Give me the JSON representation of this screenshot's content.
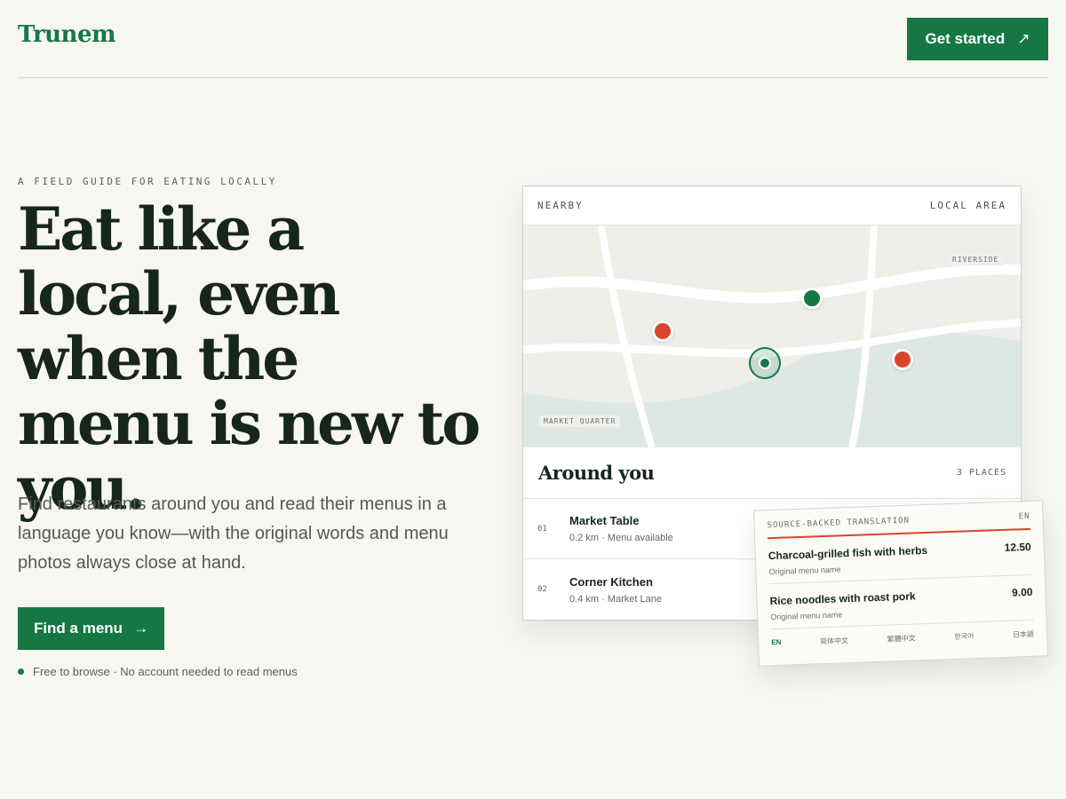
{
  "header": {
    "logo": "Trunem",
    "cta_label": "Get started",
    "cta_icon": "arrow-up-right-icon"
  },
  "hero": {
    "eyebrow": "A FIELD GUIDE FOR EATING LOCALLY",
    "headline": "Eat like a local, even when the menu is new to you.",
    "lead": "Find restaurants around you and read their menus in a language you know—with the original words and menu photos always close at hand.",
    "cta_label": "Find a menu",
    "cta_icon": "arrow-right-icon",
    "note": "Free to browse · No account needed to read menus"
  },
  "nearby_card": {
    "left_label": "NEARBY",
    "right_label": "LOCAL AREA",
    "map": {
      "labels": [
        "RIVERSIDE",
        "MARKET QUARTER"
      ]
    },
    "around_title": "Around you",
    "count": "3 PLACES",
    "places": [
      {
        "num": "01",
        "name": "Market Table",
        "meta": "0.2 km · Menu available"
      },
      {
        "num": "02",
        "name": "Corner Kitchen",
        "meta": "0.4 km · Market Lane"
      }
    ]
  },
  "translation_card": {
    "title": "SOURCE-BACKED TRANSLATION",
    "lang": "EN",
    "items": [
      {
        "name": "Charcoal-grilled fish with herbs",
        "sub": "Original menu name",
        "price": "12.50"
      },
      {
        "name": "Rice noodles with roast pork",
        "sub": "Original menu name",
        "price": "9.00"
      }
    ],
    "languages": [
      "EN",
      "简体中文",
      "繁體中文",
      "한국어",
      "日本語"
    ]
  },
  "colors": {
    "brand_green": "#167744",
    "accent_red": "#d9452b",
    "background": "#f7f6f1"
  }
}
